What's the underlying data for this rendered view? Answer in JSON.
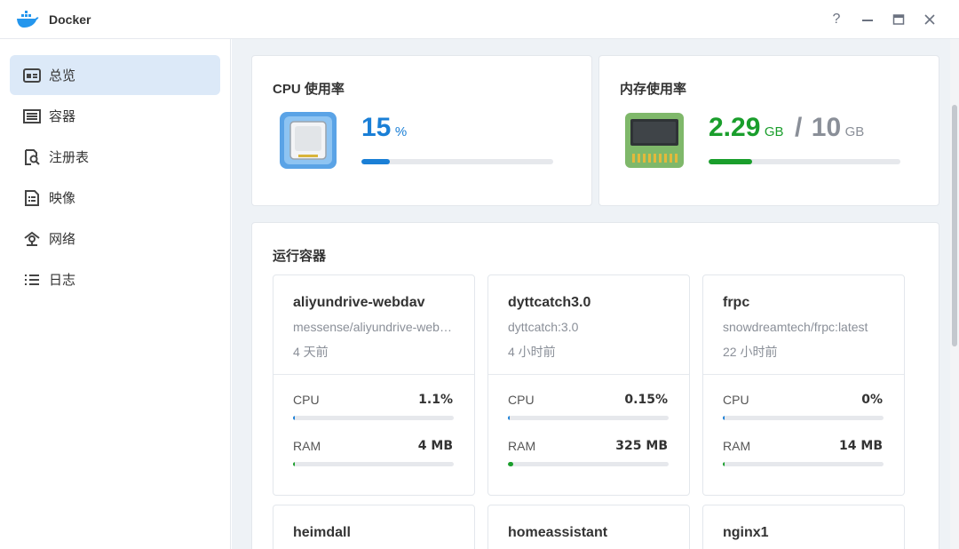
{
  "window": {
    "title": "Docker",
    "app_icon": "docker-whale-icon",
    "controls": {
      "help": "?",
      "minimize": "—",
      "maximize": "□",
      "close": "✕"
    }
  },
  "sidebar": {
    "items": [
      {
        "label": "总览",
        "icon": "overview-icon",
        "active": true
      },
      {
        "label": "容器",
        "icon": "container-icon",
        "active": false
      },
      {
        "label": "注册表",
        "icon": "registry-icon",
        "active": false
      },
      {
        "label": "映像",
        "icon": "image-icon",
        "active": false
      },
      {
        "label": "网络",
        "icon": "network-icon",
        "active": false
      },
      {
        "label": "日志",
        "icon": "log-icon",
        "active": false
      }
    ]
  },
  "cpu": {
    "title": "CPU 使用率",
    "value": "15",
    "unit": "%",
    "percent": 15,
    "color": "#1a7fd6"
  },
  "memory": {
    "title": "内存使用率",
    "used": "2.29",
    "used_unit": "GB",
    "separator": "/",
    "total": "10",
    "total_unit": "GB",
    "percent": 22.9,
    "color": "#1a9e2c"
  },
  "running": {
    "title": "运行容器",
    "cpu_label": "CPU",
    "ram_label": "RAM",
    "containers": [
      {
        "name": "aliyundrive-webdav",
        "image": "messense/aliyundrive-webdav:latest",
        "uptime": "4 天前",
        "cpu": "1.1%",
        "cpu_pct": 1.1,
        "ram": "4 MB",
        "ram_pct": 0.5
      },
      {
        "name": "dyttcatch3.0",
        "image": "dyttcatch:3.0",
        "uptime": "4 小时前",
        "cpu": "0.15%",
        "cpu_pct": 0.15,
        "ram": "325 MB",
        "ram_pct": 3.2
      },
      {
        "name": "frpc",
        "image": "snowdreamtech/frpc:latest",
        "uptime": "22 小时前",
        "cpu": "0%",
        "cpu_pct": 0,
        "ram": "14 MB",
        "ram_pct": 0.5
      },
      {
        "name": "heimdall"
      },
      {
        "name": "homeassistant"
      },
      {
        "name": "nginx1"
      }
    ]
  },
  "colors": {
    "cpu_bar": "#1a7fd6",
    "mem_bar": "#1a9e2c",
    "active_nav": "#dce9f8",
    "main_bg": "#eef2f6"
  }
}
